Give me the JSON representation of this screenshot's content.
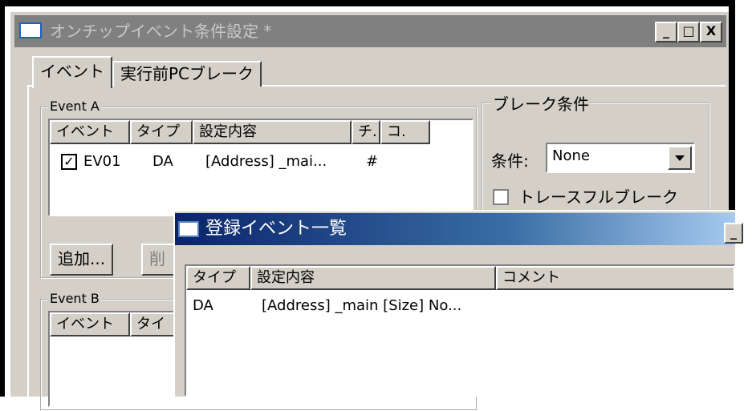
{
  "main_window": {
    "title": "オンチップイベント条件設定 *",
    "buttons": {
      "minimize": "_",
      "maximize": "□",
      "close": "X"
    }
  },
  "tabs": [
    {
      "label": "イベント"
    },
    {
      "label": "実行前PCブレーク"
    }
  ],
  "event_a": {
    "group_label": "Event A",
    "columns": [
      "イベント",
      "タイプ",
      "設定内容",
      "チ.",
      "コ."
    ],
    "rows": [
      {
        "checked": true,
        "event": "EV01",
        "type": "DA",
        "content": "[Address] _mai...",
        "ch": "#"
      }
    ],
    "add_button": "追加...",
    "partial_button": "削"
  },
  "event_b": {
    "group_label": "Event B",
    "columns": [
      "イベント",
      "タイ"
    ]
  },
  "break_condition": {
    "group_label": "ブレーク条件",
    "condition_label": "条件:",
    "condition_value": "None",
    "trace_full_label": "トレースフルブレーク",
    "trace_full_checked": false
  },
  "registered_events": {
    "title": "登録イベント一覧",
    "minimize": "_",
    "columns": [
      "タイプ",
      "設定内容",
      "コメント"
    ],
    "rows": [
      {
        "type": "DA",
        "content": "[Address] _main [Size] No...",
        "comment": ""
      }
    ]
  },
  "colors": {
    "dialog_face": "#d4d0c8",
    "inactive_title": "#808080",
    "active_title_start": "#0a246a",
    "active_title_end": "#a6caf0"
  }
}
